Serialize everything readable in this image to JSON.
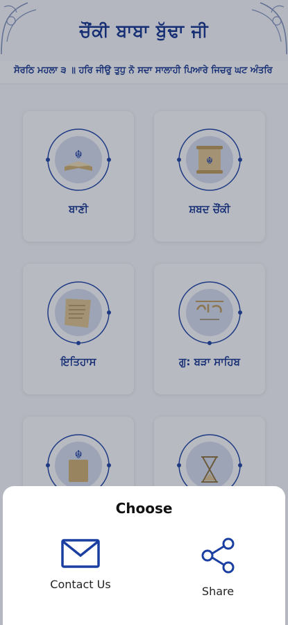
{
  "header": {
    "title": "ਚੌਂਕੀ ਬਾਬਾ ਬੁੱਢਾ ਜੀ"
  },
  "ticker": {
    "text": "ਸੋਰਠਿ ਮਹਲਾ ੩ ॥ ਹਰਿ ਜੀਉ ਤੁਧੁ ਨੋ ਸਦਾ ਸਾਲਾਹੀ ਪਿਆਰੇ ਜਿਚਰੁ ਘਟ ਅੰਤਰਿ"
  },
  "menu": {
    "cards": [
      {
        "label": "ਬਾਣੀ",
        "icon": "book-khanda-icon"
      },
      {
        "label": "ਸ਼ਬਦ ਚੌਂਕੀ",
        "icon": "scroll-khanda-icon"
      },
      {
        "label": "ਇਤਿਹਾਸ",
        "icon": "history-scroll-icon"
      },
      {
        "label": "ਗੁ: ਬੜਾ ਸਾਹਿਬ",
        "icon": "gurdwara-logo-icon"
      },
      {
        "label": "",
        "icon": "book-khanda-icon"
      },
      {
        "label": "",
        "icon": "hourglass-icon"
      }
    ]
  },
  "sheet": {
    "title": "Choose",
    "actions": [
      {
        "label": "Contact Us",
        "icon": "mail-icon"
      },
      {
        "label": "Share",
        "icon": "share-icon"
      }
    ]
  },
  "colors": {
    "primary": "#0d2f8a",
    "icon": "#1a3fa0",
    "overlay": "rgba(40,48,66,0.30)"
  }
}
